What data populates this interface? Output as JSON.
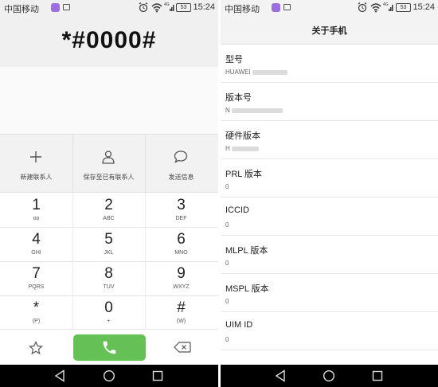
{
  "left_phone": {
    "statusbar": {
      "carrier": "中国移动",
      "signal": "4G",
      "battery": "53",
      "time": "15:24"
    },
    "dial_input": "*#0000#",
    "actions": [
      {
        "label": "新建联系人",
        "icon": "plus-icon"
      },
      {
        "label": "保存至已有联系人",
        "icon": "person-icon"
      },
      {
        "label": "发送信息",
        "icon": "message-icon"
      }
    ],
    "keys": [
      {
        "digit": "1",
        "letters": "oo"
      },
      {
        "digit": "2",
        "letters": "ABC"
      },
      {
        "digit": "3",
        "letters": "DEF"
      },
      {
        "digit": "4",
        "letters": "GHI"
      },
      {
        "digit": "5",
        "letters": "JKL"
      },
      {
        "digit": "6",
        "letters": "MNO"
      },
      {
        "digit": "7",
        "letters": "PQRS"
      },
      {
        "digit": "8",
        "letters": "TUV"
      },
      {
        "digit": "9",
        "letters": "WXYZ"
      },
      {
        "digit": "*",
        "letters": "(P)"
      },
      {
        "digit": "0",
        "letters": "+"
      },
      {
        "digit": "#",
        "letters": "(W)"
      }
    ],
    "bottom": {
      "left_icon": "star-icon",
      "center_icon": "phone-icon",
      "right_icon": "backspace-icon",
      "call_color": "#65c155"
    }
  },
  "right_phone": {
    "statusbar": {
      "carrier": "中国移动",
      "signal": "4G",
      "battery": "53",
      "time": "15:24"
    },
    "title": "关于手机",
    "items": [
      {
        "title": "型号",
        "value": "HUAWEI"
      },
      {
        "title": "版本号",
        "value": "N"
      },
      {
        "title": "硬件版本",
        "value": "H"
      },
      {
        "title": "PRL 版本",
        "value": "0"
      },
      {
        "title": "ICCID",
        "value": "0"
      },
      {
        "title": "MLPL 版本",
        "value": "0"
      },
      {
        "title": "MSPL 版本",
        "value": "0"
      },
      {
        "title": "UIM ID",
        "value": "0"
      }
    ]
  },
  "navbar": {
    "icons": [
      "back-icon",
      "home-icon",
      "recents-icon"
    ]
  }
}
